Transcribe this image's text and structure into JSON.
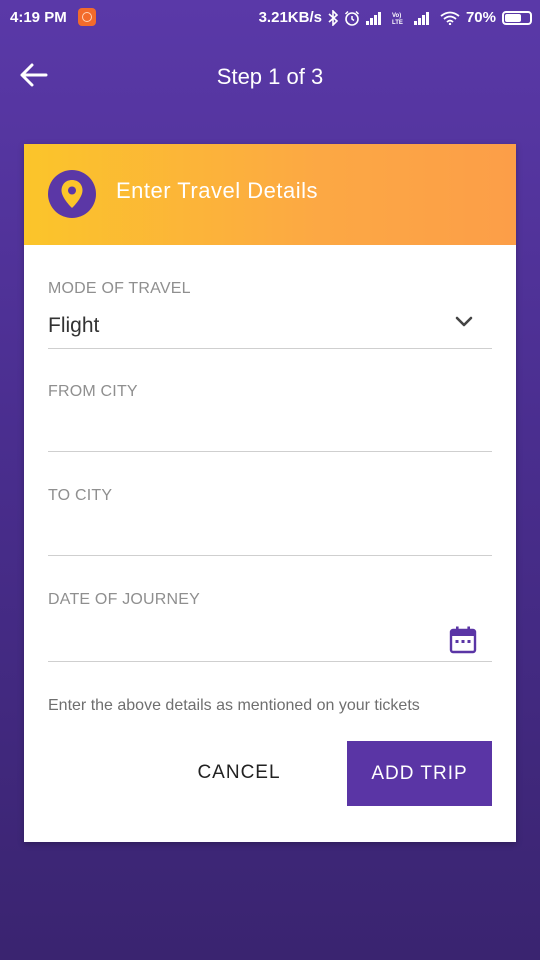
{
  "status_bar": {
    "time": "4:19 PM",
    "network_speed": "3.21KB/s",
    "battery_percent": "70%",
    "battery_level": 0.7
  },
  "app_bar": {
    "title": "Step 1 of 3"
  },
  "card": {
    "header_title": "Enter Travel Details",
    "fields": {
      "mode_of_travel": {
        "label": "MODE OF TRAVEL",
        "value": "Flight"
      },
      "from_city": {
        "label": "FROM CITY",
        "value": ""
      },
      "to_city": {
        "label": "TO CITY",
        "value": ""
      },
      "date_of_journey": {
        "label": "DATE OF JOURNEY",
        "value": ""
      }
    },
    "hint": "Enter the above details as mentioned on your tickets",
    "cancel_label": "CANCEL",
    "add_label": "ADD TRIP"
  },
  "colors": {
    "accent": "#5a35a5",
    "header_gradient_start": "#fbc52a",
    "header_gradient_end": "#fc9e48"
  }
}
